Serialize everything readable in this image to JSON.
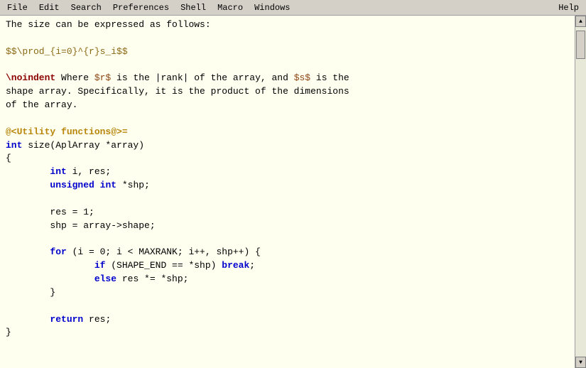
{
  "menubar": {
    "items": [
      "File",
      "Edit",
      "Search",
      "Preferences",
      "Shell",
      "Macro",
      "Windows",
      "Help"
    ]
  },
  "editor": {
    "background": "#fffff0",
    "content_lines": [
      "The size can be expressed as follows:",
      "",
      "$$\\prod_{i=0}^{r}s_i$$",
      "",
      "\\noindent Where $r$ is the |rank| of the array, and $s$ is the",
      "shape array. Specifically, it is the product of the dimensions",
      "of the array.",
      "",
      "@<Utility functions@>=",
      "int size(AplArray *array)",
      "{",
      "        int i, res;",
      "        unsigned int *shp;",
      "",
      "        res = 1;",
      "        shp = array->shape;",
      "",
      "        for (i = 0; i < MAXRANK; i++, shp++) {",
      "                if (SHAPE_END == *shp) break;",
      "                else res *= *shp;",
      "        }",
      "",
      "        return res;",
      "}"
    ]
  }
}
